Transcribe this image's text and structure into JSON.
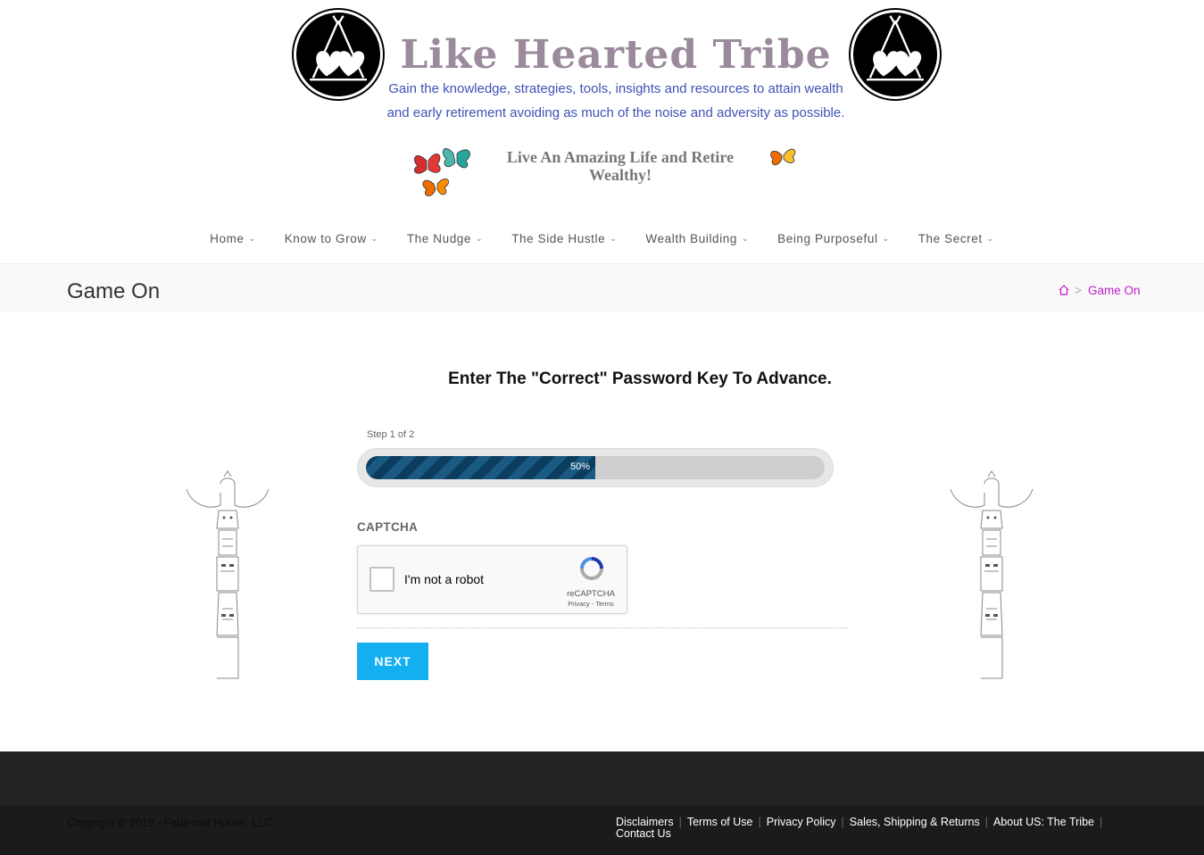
{
  "header": {
    "site_title": "Like Hearted Tribe",
    "tagline_line1": "Gain the knowledge, strategies, tools, insights and resources to attain wealth",
    "tagline_line2": "and early retirement avoiding as much of the noise and adversity as possible.",
    "slogan": "Live An Amazing Life and Retire Wealthy!",
    "logo_icon": "teepee-hearts-icon",
    "butterfly_icon": "butterfly-icon"
  },
  "nav": {
    "items": [
      {
        "label": "Home"
      },
      {
        "label": "Know to Grow"
      },
      {
        "label": "The Nudge"
      },
      {
        "label": "The Side Hustle"
      },
      {
        "label": "Wealth Building"
      },
      {
        "label": "Being Purposeful"
      },
      {
        "label": "The Secret"
      }
    ]
  },
  "page": {
    "title": "Game On",
    "breadcrumb": {
      "home_icon": "home-icon",
      "separator": ">",
      "current": "Game On"
    }
  },
  "form": {
    "heading": "Enter The \"Correct\" Password Key To Advance.",
    "step_text": "Step 1 of 2",
    "progress_percent": 50,
    "progress_label": "50%",
    "captcha_label": "CAPTCHA",
    "recaptcha": {
      "checkbox_text": "I'm not a robot",
      "brand": "reCAPTCHA",
      "links": "Privacy - Terms"
    },
    "next_label": "NEXT"
  },
  "footer": {
    "copyright": "Copyright © 2019 - Faux-naif House, LLC",
    "links": [
      "Disclaimers",
      "Terms of Use",
      "Privacy Policy",
      "Sales, Shipping & Returns",
      "About US: The Tribe",
      "Contact Us"
    ]
  },
  "colors": {
    "accent": "#13aff0",
    "breadcrumb": "#c01ec9",
    "tagline": "#3f51b5",
    "progress": "#0c3d5e"
  }
}
